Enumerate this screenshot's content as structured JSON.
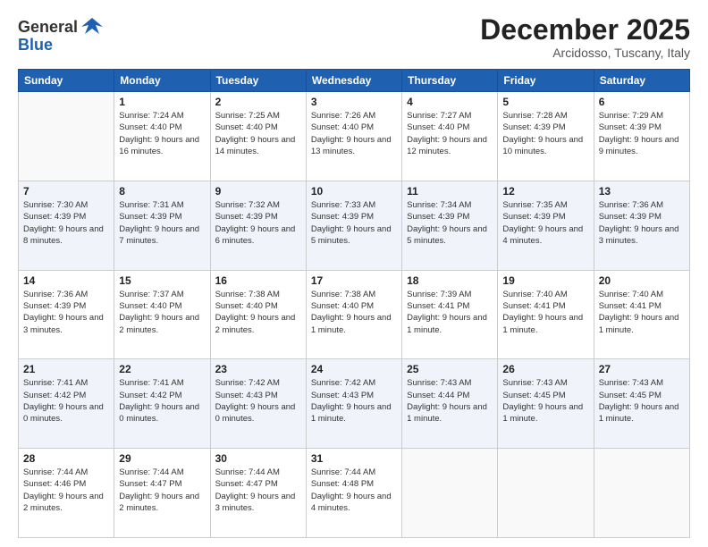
{
  "header": {
    "logo_general": "General",
    "logo_blue": "Blue",
    "month": "December 2025",
    "location": "Arcidosso, Tuscany, Italy"
  },
  "weekdays": [
    "Sunday",
    "Monday",
    "Tuesday",
    "Wednesday",
    "Thursday",
    "Friday",
    "Saturday"
  ],
  "weeks": [
    [
      {
        "day": null,
        "sunrise": null,
        "sunset": null,
        "daylight": null
      },
      {
        "day": "1",
        "sunrise": "Sunrise: 7:24 AM",
        "sunset": "Sunset: 4:40 PM",
        "daylight": "Daylight: 9 hours and 16 minutes."
      },
      {
        "day": "2",
        "sunrise": "Sunrise: 7:25 AM",
        "sunset": "Sunset: 4:40 PM",
        "daylight": "Daylight: 9 hours and 14 minutes."
      },
      {
        "day": "3",
        "sunrise": "Sunrise: 7:26 AM",
        "sunset": "Sunset: 4:40 PM",
        "daylight": "Daylight: 9 hours and 13 minutes."
      },
      {
        "day": "4",
        "sunrise": "Sunrise: 7:27 AM",
        "sunset": "Sunset: 4:40 PM",
        "daylight": "Daylight: 9 hours and 12 minutes."
      },
      {
        "day": "5",
        "sunrise": "Sunrise: 7:28 AM",
        "sunset": "Sunset: 4:39 PM",
        "daylight": "Daylight: 9 hours and 10 minutes."
      },
      {
        "day": "6",
        "sunrise": "Sunrise: 7:29 AM",
        "sunset": "Sunset: 4:39 PM",
        "daylight": "Daylight: 9 hours and 9 minutes."
      }
    ],
    [
      {
        "day": "7",
        "sunrise": "Sunrise: 7:30 AM",
        "sunset": "Sunset: 4:39 PM",
        "daylight": "Daylight: 9 hours and 8 minutes."
      },
      {
        "day": "8",
        "sunrise": "Sunrise: 7:31 AM",
        "sunset": "Sunset: 4:39 PM",
        "daylight": "Daylight: 9 hours and 7 minutes."
      },
      {
        "day": "9",
        "sunrise": "Sunrise: 7:32 AM",
        "sunset": "Sunset: 4:39 PM",
        "daylight": "Daylight: 9 hours and 6 minutes."
      },
      {
        "day": "10",
        "sunrise": "Sunrise: 7:33 AM",
        "sunset": "Sunset: 4:39 PM",
        "daylight": "Daylight: 9 hours and 5 minutes."
      },
      {
        "day": "11",
        "sunrise": "Sunrise: 7:34 AM",
        "sunset": "Sunset: 4:39 PM",
        "daylight": "Daylight: 9 hours and 5 minutes."
      },
      {
        "day": "12",
        "sunrise": "Sunrise: 7:35 AM",
        "sunset": "Sunset: 4:39 PM",
        "daylight": "Daylight: 9 hours and 4 minutes."
      },
      {
        "day": "13",
        "sunrise": "Sunrise: 7:36 AM",
        "sunset": "Sunset: 4:39 PM",
        "daylight": "Daylight: 9 hours and 3 minutes."
      }
    ],
    [
      {
        "day": "14",
        "sunrise": "Sunrise: 7:36 AM",
        "sunset": "Sunset: 4:39 PM",
        "daylight": "Daylight: 9 hours and 3 minutes."
      },
      {
        "day": "15",
        "sunrise": "Sunrise: 7:37 AM",
        "sunset": "Sunset: 4:40 PM",
        "daylight": "Daylight: 9 hours and 2 minutes."
      },
      {
        "day": "16",
        "sunrise": "Sunrise: 7:38 AM",
        "sunset": "Sunset: 4:40 PM",
        "daylight": "Daylight: 9 hours and 2 minutes."
      },
      {
        "day": "17",
        "sunrise": "Sunrise: 7:38 AM",
        "sunset": "Sunset: 4:40 PM",
        "daylight": "Daylight: 9 hours and 1 minute."
      },
      {
        "day": "18",
        "sunrise": "Sunrise: 7:39 AM",
        "sunset": "Sunset: 4:41 PM",
        "daylight": "Daylight: 9 hours and 1 minute."
      },
      {
        "day": "19",
        "sunrise": "Sunrise: 7:40 AM",
        "sunset": "Sunset: 4:41 PM",
        "daylight": "Daylight: 9 hours and 1 minute."
      },
      {
        "day": "20",
        "sunrise": "Sunrise: 7:40 AM",
        "sunset": "Sunset: 4:41 PM",
        "daylight": "Daylight: 9 hours and 1 minute."
      }
    ],
    [
      {
        "day": "21",
        "sunrise": "Sunrise: 7:41 AM",
        "sunset": "Sunset: 4:42 PM",
        "daylight": "Daylight: 9 hours and 0 minutes."
      },
      {
        "day": "22",
        "sunrise": "Sunrise: 7:41 AM",
        "sunset": "Sunset: 4:42 PM",
        "daylight": "Daylight: 9 hours and 0 minutes."
      },
      {
        "day": "23",
        "sunrise": "Sunrise: 7:42 AM",
        "sunset": "Sunset: 4:43 PM",
        "daylight": "Daylight: 9 hours and 0 minutes."
      },
      {
        "day": "24",
        "sunrise": "Sunrise: 7:42 AM",
        "sunset": "Sunset: 4:43 PM",
        "daylight": "Daylight: 9 hours and 1 minute."
      },
      {
        "day": "25",
        "sunrise": "Sunrise: 7:43 AM",
        "sunset": "Sunset: 4:44 PM",
        "daylight": "Daylight: 9 hours and 1 minute."
      },
      {
        "day": "26",
        "sunrise": "Sunrise: 7:43 AM",
        "sunset": "Sunset: 4:45 PM",
        "daylight": "Daylight: 9 hours and 1 minute."
      },
      {
        "day": "27",
        "sunrise": "Sunrise: 7:43 AM",
        "sunset": "Sunset: 4:45 PM",
        "daylight": "Daylight: 9 hours and 1 minute."
      }
    ],
    [
      {
        "day": "28",
        "sunrise": "Sunrise: 7:44 AM",
        "sunset": "Sunset: 4:46 PM",
        "daylight": "Daylight: 9 hours and 2 minutes."
      },
      {
        "day": "29",
        "sunrise": "Sunrise: 7:44 AM",
        "sunset": "Sunset: 4:47 PM",
        "daylight": "Daylight: 9 hours and 2 minutes."
      },
      {
        "day": "30",
        "sunrise": "Sunrise: 7:44 AM",
        "sunset": "Sunset: 4:47 PM",
        "daylight": "Daylight: 9 hours and 3 minutes."
      },
      {
        "day": "31",
        "sunrise": "Sunrise: 7:44 AM",
        "sunset": "Sunset: 4:48 PM",
        "daylight": "Daylight: 9 hours and 4 minutes."
      },
      {
        "day": null,
        "sunrise": null,
        "sunset": null,
        "daylight": null
      },
      {
        "day": null,
        "sunrise": null,
        "sunset": null,
        "daylight": null
      },
      {
        "day": null,
        "sunrise": null,
        "sunset": null,
        "daylight": null
      }
    ]
  ]
}
